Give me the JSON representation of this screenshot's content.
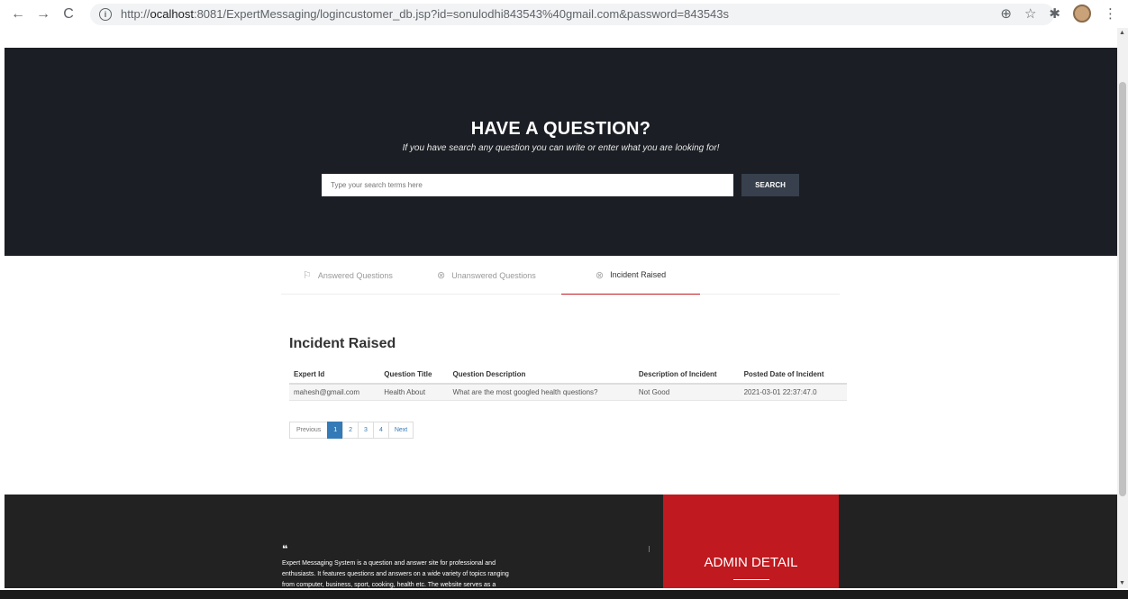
{
  "browser": {
    "url_prefix": "http://",
    "url_host": "ocalhost",
    "url_rest": ":8081/ExpertMessaging/logincustomer_db.jsp?id=sonulodhi843543%40gmail.com&password=843543s",
    "back_icon": "←",
    "forward_icon": "→",
    "reload_icon": "C",
    "info_icon": "i",
    "zoom_icon": "⊕",
    "star_icon": "☆",
    "puzzle_icon": "✱",
    "menu_icon": "⋮"
  },
  "hero": {
    "title": "HAVE A QUESTION?",
    "subtitle": "If you have search any question you can write or enter what you are looking for!",
    "search_placeholder": "Type your search terms here",
    "search_button": "SEARCH"
  },
  "tabs": [
    {
      "label": "Answered Questions",
      "icon": "⚐"
    },
    {
      "label": "Unanswered Questions",
      "icon": "⊗"
    },
    {
      "label": "Incident Raised",
      "icon": "⊗"
    }
  ],
  "section_title": "Incident Raised",
  "table": {
    "headers": [
      "Expert Id",
      "Question Title",
      "Question Description",
      "Description of Incident",
      "Posted Date of Incident"
    ],
    "rows": [
      [
        "mahesh@gmail.com",
        "Health About",
        "What are the most googled health questions?",
        "Not Good",
        "2021-03-01 22:37:47.0"
      ]
    ]
  },
  "pagination": {
    "previous": "Previous",
    "pages": [
      "1",
      "2",
      "3",
      "4"
    ],
    "next": "Next"
  },
  "footer": {
    "quote_mark": "❝",
    "text_line1": "Expert Messaging System is a question and answer site for professional and",
    "text_line2": "enthusiasts. It features questions and answers on a wide variety of topics ranging",
    "text_line3": "from computer, business, sport, cooking, health etc. The website serves as a",
    "admin_title": "ADMIN DETAIL"
  },
  "colors": {
    "hero_bg": "#1b1e24",
    "accent_red": "#c0191f",
    "footer_bg": "#222222",
    "pager_active": "#337ab7"
  }
}
